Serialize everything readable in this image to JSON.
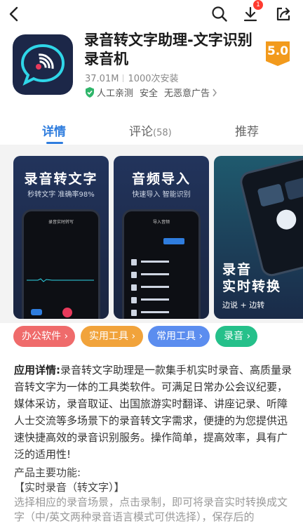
{
  "header": {
    "download_badge": "1"
  },
  "app": {
    "title": "录音转文字助理-文字识别录音机",
    "size": "37.01M",
    "installs": "1000次安装",
    "verified": "人工亲测",
    "safe": "安全",
    "no_ads": "无恶意广告",
    "rating": "5.0"
  },
  "tabs": [
    {
      "label": "详情"
    },
    {
      "label": "评论",
      "count": "(58)"
    },
    {
      "label": "推荐"
    }
  ],
  "screenshots": [
    {
      "headline": "录音转文字",
      "sub": "秒转文字 准确率98%",
      "screen": "录音实时转写"
    },
    {
      "headline": "音频导入",
      "sub": "快速导入 智能识别",
      "screen": "导入音频"
    },
    {
      "headline": "录音\n实时转换",
      "sub": "边说 + 边转"
    }
  ],
  "tags": [
    {
      "label": "办公软件",
      "color": "#ef6b6b"
    },
    {
      "label": "实用工具",
      "color": "#f1a33b"
    },
    {
      "label": "常用工具",
      "color": "#5b8def"
    },
    {
      "label": "录音",
      "color": "#25c08a"
    }
  ],
  "description": {
    "label": "应用详情:",
    "text": "录音转文字助理是一款集手机实时录音、高质量录音转文字为一体的工具类软件。可满足日常办公会议纪要，媒体采访，录音取证、出国旅游实时翻译、讲座记录、听障人士交流等多场景下的录音转文字需求，便捷的为您提供迅速快捷高效的录音识别服务。操作简单，提高效率，具有广泛的适用性!"
  },
  "features": {
    "heading": "产品主要功能:",
    "item1": "【实时录音（转文字）】",
    "item1_desc": "选择相应的录音场景，点击录制，即可将录音实时转换成文字（中/英文两种录音语言模式可供选择），保存后的"
  }
}
